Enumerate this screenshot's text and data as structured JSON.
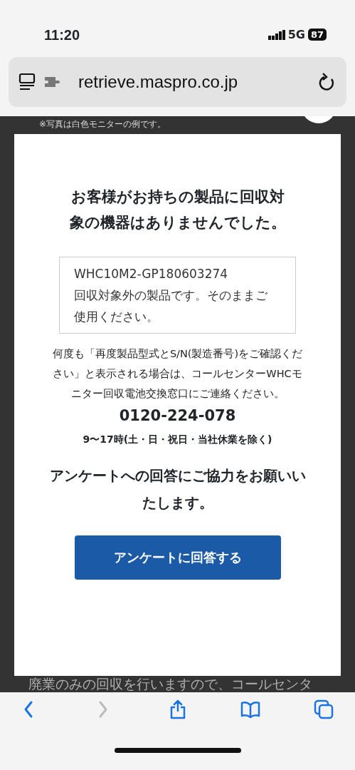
{
  "status_bar": {
    "time": "11:20",
    "network": "5G",
    "battery": "87"
  },
  "address_bar": {
    "url": "retrieve.maspro.co.jp"
  },
  "background_page": {
    "note": "※写真は白色モニターの例です。",
    "text": "廃業のみの回収を行いますので、コールセンタ"
  },
  "dialog": {
    "heading": "お客様がお持ちの製品に回収対象の機器はありませんでした。",
    "result": {
      "model": "WHC10M2-GP180603274",
      "message": "回収対象外の製品です。そのままご使用ください。"
    },
    "instructions": "何度も「再度製品型式とS/N(製造番号)をご確認ください」と表示される場合は、コールセンターWHCモニター回収電池交換窓口にご連絡ください。",
    "phone": "0120-224-078",
    "hours": "9〜17時(土・日・祝日・当社休業を除く)",
    "survey_prompt": "アンケートへの回答にご協力をお願いいたします。",
    "survey_button": "アンケートに回答する"
  },
  "toolbar": [
    {
      "kind": "back",
      "disabled": false
    },
    {
      "kind": "forward",
      "disabled": true
    },
    {
      "kind": "share",
      "disabled": false
    },
    {
      "kind": "bookmarks",
      "disabled": false
    },
    {
      "kind": "tabs",
      "disabled": false
    }
  ]
}
